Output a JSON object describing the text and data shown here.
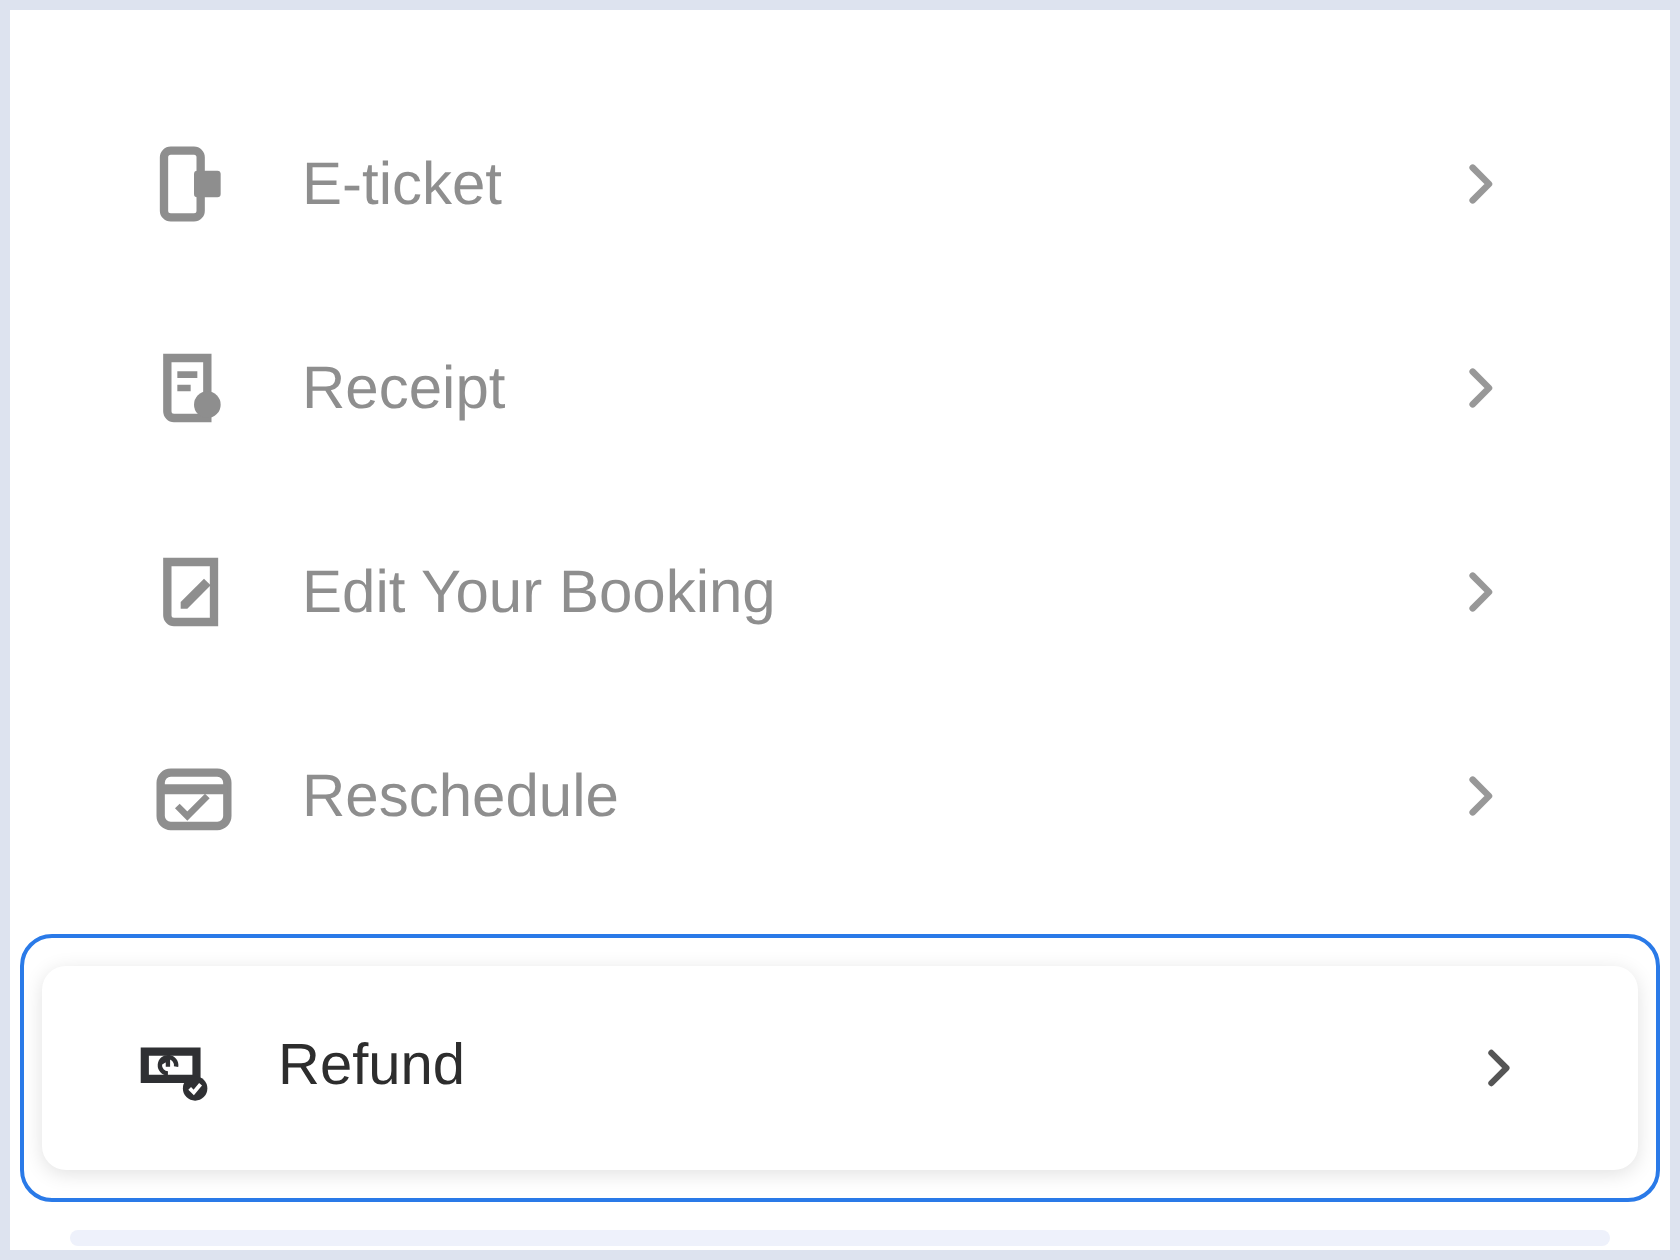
{
  "menu_items": [
    {
      "label": "E-ticket",
      "focused": false
    },
    {
      "label": "Receipt",
      "focused": false
    },
    {
      "label": "Edit Your Booking",
      "focused": false
    },
    {
      "label": "Reschedule",
      "focused": false
    },
    {
      "label": "Refund",
      "focused": true
    }
  ]
}
